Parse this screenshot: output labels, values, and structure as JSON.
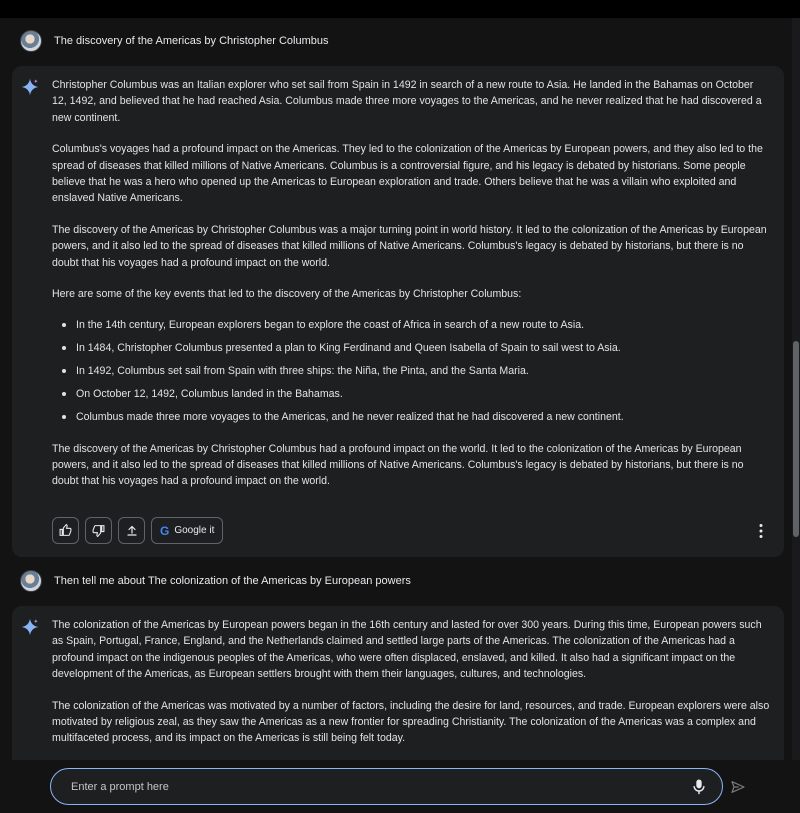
{
  "conversation": [
    {
      "user_prompt": "The discovery of the Americas by Christopher Columbus",
      "response": {
        "p1": "Christopher Columbus was an Italian explorer who set sail from Spain in 1492 in search of a new route to Asia. He landed in the Bahamas on October 12, 1492, and believed that he had reached Asia. Columbus made three more voyages to the Americas, and he never realized that he had discovered a new continent.",
        "p2": "Columbus's voyages had a profound impact on the Americas. They led to the colonization of the Americas by European powers, and they also led to the spread of diseases that killed millions of Native Americans. Columbus is a controversial figure, and his legacy is debated by historians. Some people believe that he was a hero who opened up the Americas to European exploration and trade. Others believe that he was a villain who exploited and enslaved Native Americans.",
        "p3": "The discovery of the Americas by Christopher Columbus was a major turning point in world history. It led to the colonization of the Americas by European powers, and it also led to the spread of diseases that killed millions of Native Americans. Columbus's legacy is debated by historians, but there is no doubt that his voyages had a profound impact on the world.",
        "p4": "Here are some of the key events that led to the discovery of the Americas by Christopher Columbus:",
        "bullets": [
          "In the 14th century, European explorers began to explore the coast of Africa in search of a new route to Asia.",
          "In 1484, Christopher Columbus presented a plan to King Ferdinand and Queen Isabella of Spain to sail west to Asia.",
          "In 1492, Columbus set sail from Spain with three ships: the Niña, the Pinta, and the Santa Maria.",
          "On October 12, 1492, Columbus landed in the Bahamas.",
          "Columbus made three more voyages to the Americas, and he never realized that he had discovered a new continent."
        ],
        "p5": "The discovery of the Americas by Christopher Columbus had a profound impact on the world. It led to the colonization of the Americas by European powers, and it also led to the spread of diseases that killed millions of Native Americans. Columbus's legacy is debated by historians, but there is no doubt that his voyages had a profound impact on the world."
      },
      "actions": {
        "google_it_label": "Google it",
        "google_letter": "G"
      }
    },
    {
      "user_prompt": "Then  tell me about The colonization of the Americas by European powers",
      "response": {
        "p1": "The colonization of the Americas by European powers began in the 16th century and lasted for over 300 years. During this time, European powers such as Spain, Portugal, France, England, and the Netherlands claimed and settled large parts of the Americas. The colonization of the Americas had a profound impact on the indigenous peoples of the Americas, who were often displaced, enslaved, and killed. It also had a significant impact on the development of the Americas, as European settlers brought with them their languages, cultures, and technologies.",
        "p2": "The colonization of the Americas was motivated by a number of factors, including the desire for land, resources, and trade. European explorers were also motivated by religious zeal, as they saw the Americas as a new frontier for spreading Christianity. The colonization of the Americas was a complex and multifaceted process, and its impact on the Americas is still being felt today."
      }
    }
  ],
  "input": {
    "placeholder": "Enter a prompt here",
    "value": ""
  },
  "icons": {
    "avatar": "avatar",
    "assistant": "sparkle-icon",
    "thumbs_up": "thumbs-up-icon",
    "thumbs_down": "thumbs-down-icon",
    "share": "share-icon",
    "more": "more-vert-icon",
    "mic": "mic-icon",
    "send": "send-icon"
  },
  "colors": {
    "background": "#131314",
    "response_card": "#1e1f20",
    "input_border": "#8ab4f8",
    "google_blue": "#4285f4"
  }
}
